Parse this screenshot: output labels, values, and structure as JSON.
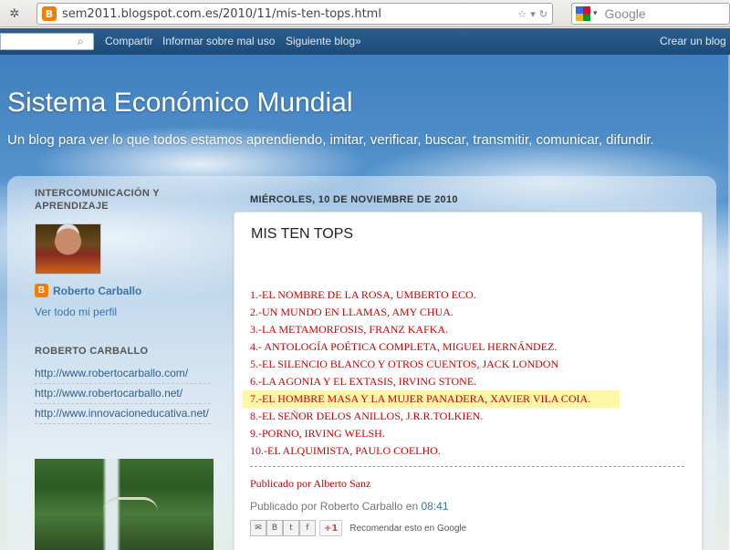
{
  "browser": {
    "url": "sem2011.blogspot.com.es/2010/11/mis-ten-tops.html",
    "search_placeholder": "Google"
  },
  "navbar": {
    "links": [
      "Compartir",
      "Informar sobre mal uso",
      "Siguiente blog»"
    ],
    "create_blog": "Crear un blog"
  },
  "blog": {
    "title": "Sistema Económico Mundial",
    "description": "Un blog para ver lo que todos estamos aprendiendo, imitar, verificar, buscar, transmitir, comunicar, difundir."
  },
  "sidebar": {
    "heading1": "INTERCOMUNICACIÓN Y APRENDIZAJE",
    "profile_name": "Roberto Carballo",
    "profile_link": "Ver todo mi perfil",
    "heading2": "ROBERTO CARBALLO",
    "links": [
      "http://www.robertocarballo.com/",
      "http://www.robertocarballo.net/",
      "http://www.innovacioneducativa.net/"
    ]
  },
  "post": {
    "date": "MIÉRCOLES, 10 DE NOVIEMBRE DE 2010",
    "title": "MIS TEN TOPS",
    "tops": [
      "1.-EL NOMBRE DE LA ROSA, UMBERTO ECO.",
      "2.-UN MUNDO EN LLAMAS, AMY CHUA.",
      "3.-LA METAMORFOSIS, FRANZ KAFKA.",
      "4.- ANTOLOGÍA POÉTICA COMPLETA, MIGUEL HERNÁNDEZ.",
      "5.-EL SILENCIO BLANCO Y OTROS CUENTOS, JACK LONDON",
      "6.-LA AGONIA Y EL EXTASIS, IRVING STONE.",
      "7.-EL HOMBRE MASA Y LA MUJER PANADERA, XAVIER VILA COIA.",
      "8.-EL SEÑOR DELOS ANILLOS, J.R.R.TOLKIEN.",
      "9.-PORNO, IRVING WELSH.",
      "10.-EL ALQUIMISTA, PAULO COELHO."
    ],
    "published_by_alberto": "Publicado por Alberto Sanz",
    "published_prefix": "Publicado por Roberto Carballo en",
    "published_time": "08:41",
    "plus_one": "+1",
    "recommend": "Recomendar esto en Google"
  },
  "colors": {
    "navbar": "#1b4a78",
    "link": "#3a73ad",
    "tops_text": "#cc0000",
    "highlight": "#fff7a8"
  },
  "icons": [
    "menu-icon",
    "blogger-favicon",
    "star-icon",
    "dropdown-icon",
    "reload-icon",
    "google-icon",
    "search-icon",
    "blogger-icon",
    "email-icon",
    "blogthis-icon",
    "twitter-icon",
    "facebook-icon"
  ]
}
